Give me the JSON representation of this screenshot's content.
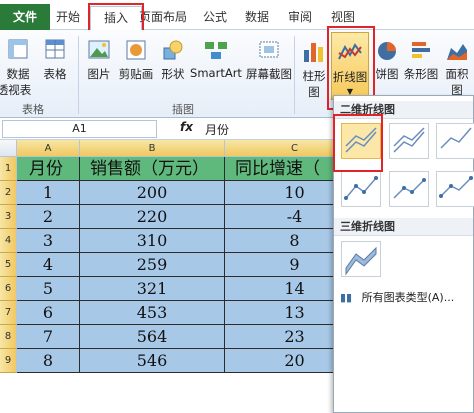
{
  "ribbon_tabs": [
    {
      "label": "文件",
      "type": "file"
    },
    {
      "label": "开始"
    },
    {
      "label": "插入",
      "active": true
    },
    {
      "label": "页面布局"
    },
    {
      "label": "公式"
    },
    {
      "label": "数据"
    },
    {
      "label": "审阅"
    },
    {
      "label": "视图"
    }
  ],
  "ribbon": {
    "buttons": [
      "数据",
      "表格",
      "图片",
      "剪贴画",
      "形状",
      "SmartArt",
      "屏幕截图",
      "柱形图",
      "折线图",
      "饼图",
      "条形图",
      "面积图"
    ],
    "pivot_sub": "透视表",
    "groups": {
      "tables": "表格",
      "illustrations": "插图"
    }
  },
  "formula_bar": {
    "name_box": "A1",
    "fx": "fx",
    "value": "月份"
  },
  "columns": [
    "A",
    "B",
    "C"
  ],
  "rows": [
    "1",
    "2",
    "3",
    "4",
    "5",
    "6",
    "7",
    "8",
    "9"
  ],
  "table": {
    "headers": [
      "月份",
      "销售额（万元）",
      "同比增速（"
    ],
    "data": [
      [
        "1",
        "200",
        "10"
      ],
      [
        "2",
        "220",
        "-4"
      ],
      [
        "3",
        "310",
        "8"
      ],
      [
        "4",
        "259",
        "9"
      ],
      [
        "5",
        "321",
        "14"
      ],
      [
        "6",
        "453",
        "13"
      ],
      [
        "7",
        "564",
        "23"
      ],
      [
        "8",
        "546",
        "20"
      ]
    ]
  },
  "dropdown": {
    "section_2d": "二维折线图",
    "section_3d": "三维折线图",
    "all_types": "所有图表类型(A)..."
  }
}
